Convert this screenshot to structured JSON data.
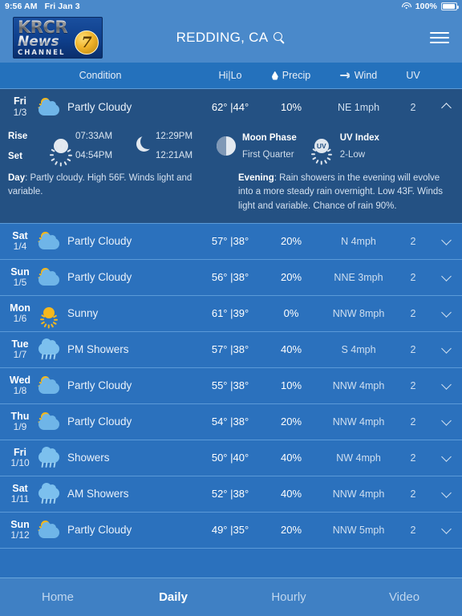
{
  "statusbar": {
    "time": "9:56 AM",
    "date": "Fri Jan 3",
    "battery_pct": "100%",
    "wifi_icon": "wifi-icon",
    "battery_icon": "battery-icon"
  },
  "header": {
    "brand_krcr": "KRCR",
    "brand_news": "News",
    "brand_channel": "CHANNEL",
    "brand_seven": "7",
    "city": "REDDING, CA",
    "search_icon": "search-icon",
    "menu_icon": "hamburger-menu-icon"
  },
  "columns": {
    "condition": "Condition",
    "hilo": "Hi|Lo",
    "precip": "Precip",
    "wind": "Wind",
    "uv": "UV",
    "precip_icon": "water-drop-icon",
    "wind_icon": "wind-arrow-icon"
  },
  "colors": {
    "page_bg": "#2b71bd",
    "nav_bg": "#4a89ca",
    "colhead_bg": "#2471bc",
    "row_bg": "#2b71bd",
    "row_expanded_bg": "#245183",
    "divider": "#5b9ad8",
    "tabbar_bg": "#3f80c4",
    "sun_yellow": "#f5b81e",
    "cloud_blue": "#6fb5e8",
    "text_primary": "#ffffff",
    "text_muted": "#cfdff0"
  },
  "expanded_detail": {
    "rise_label": "Rise",
    "set_label": "Set",
    "sun_rise": "07:33AM",
    "sun_set": "04:54PM",
    "moon_rise": "12:29PM",
    "moon_set": "12:21AM",
    "moon_phase_label": "Moon Phase",
    "moon_phase_value": "First Quarter",
    "uv_index_label": "UV Index",
    "uv_index_value": "2-Low",
    "uv_badge": "UV",
    "day_label": "Day",
    "day_text": ": Partly cloudy. High 56F. Winds light and variable.",
    "evening_label": "Evening",
    "evening_text": ": Rain showers in the evening will evolve into a more steady rain overnight. Low 43F. Winds light and variable. Chance of rain 90%."
  },
  "forecast": [
    {
      "dow": "Fri",
      "date": "1/3",
      "icon": "partly-cloudy-icon",
      "condition": "Partly Cloudy",
      "hilo": "62° |44°",
      "precip": "10%",
      "wind": "NE 1mph",
      "uv": "2",
      "expanded": true,
      "chevron": "chevron-up-icon"
    },
    {
      "dow": "Sat",
      "date": "1/4",
      "icon": "partly-cloudy-icon",
      "condition": "Partly Cloudy",
      "hilo": "57° |38°",
      "precip": "20%",
      "wind": "N 4mph",
      "uv": "2",
      "expanded": false,
      "chevron": "chevron-down-icon"
    },
    {
      "dow": "Sun",
      "date": "1/5",
      "icon": "partly-cloudy-icon",
      "condition": "Partly Cloudy",
      "hilo": "56° |38°",
      "precip": "20%",
      "wind": "NNE 3mph",
      "uv": "2",
      "expanded": false,
      "chevron": "chevron-down-icon"
    },
    {
      "dow": "Mon",
      "date": "1/6",
      "icon": "sunny-icon",
      "condition": "Sunny",
      "hilo": "61° |39°",
      "precip": "0%",
      "wind": "NNW 8mph",
      "uv": "2",
      "expanded": false,
      "chevron": "chevron-down-icon"
    },
    {
      "dow": "Tue",
      "date": "1/7",
      "icon": "rain-showers-icon",
      "condition": "PM Showers",
      "hilo": "57° |38°",
      "precip": "40%",
      "wind": "S 4mph",
      "uv": "2",
      "expanded": false,
      "chevron": "chevron-down-icon"
    },
    {
      "dow": "Wed",
      "date": "1/8",
      "icon": "partly-cloudy-icon",
      "condition": "Partly Cloudy",
      "hilo": "55° |38°",
      "precip": "10%",
      "wind": "NNW 4mph",
      "uv": "2",
      "expanded": false,
      "chevron": "chevron-down-icon"
    },
    {
      "dow": "Thu",
      "date": "1/9",
      "icon": "partly-cloudy-icon",
      "condition": "Partly Cloudy",
      "hilo": "54° |38°",
      "precip": "20%",
      "wind": "NNW 4mph",
      "uv": "2",
      "expanded": false,
      "chevron": "chevron-down-icon"
    },
    {
      "dow": "Fri",
      "date": "1/10",
      "icon": "rain-showers-icon",
      "condition": "Showers",
      "hilo": "50° |40°",
      "precip": "40%",
      "wind": "NW 4mph",
      "uv": "2",
      "expanded": false,
      "chevron": "chevron-down-icon"
    },
    {
      "dow": "Sat",
      "date": "1/11",
      "icon": "rain-showers-icon",
      "condition": "AM Showers",
      "hilo": "52° |38°",
      "precip": "40%",
      "wind": "NNW 4mph",
      "uv": "2",
      "expanded": false,
      "chevron": "chevron-down-icon"
    },
    {
      "dow": "Sun",
      "date": "1/12",
      "icon": "partly-cloudy-icon",
      "condition": "Partly Cloudy",
      "hilo": "49° |35°",
      "precip": "20%",
      "wind": "NNW 5mph",
      "uv": "2",
      "expanded": false,
      "chevron": "chevron-down-icon"
    }
  ],
  "tabbar": {
    "tabs": [
      {
        "label": "Home",
        "active": false
      },
      {
        "label": "Daily",
        "active": true
      },
      {
        "label": "Hourly",
        "active": false
      },
      {
        "label": "Video",
        "active": false
      }
    ]
  }
}
